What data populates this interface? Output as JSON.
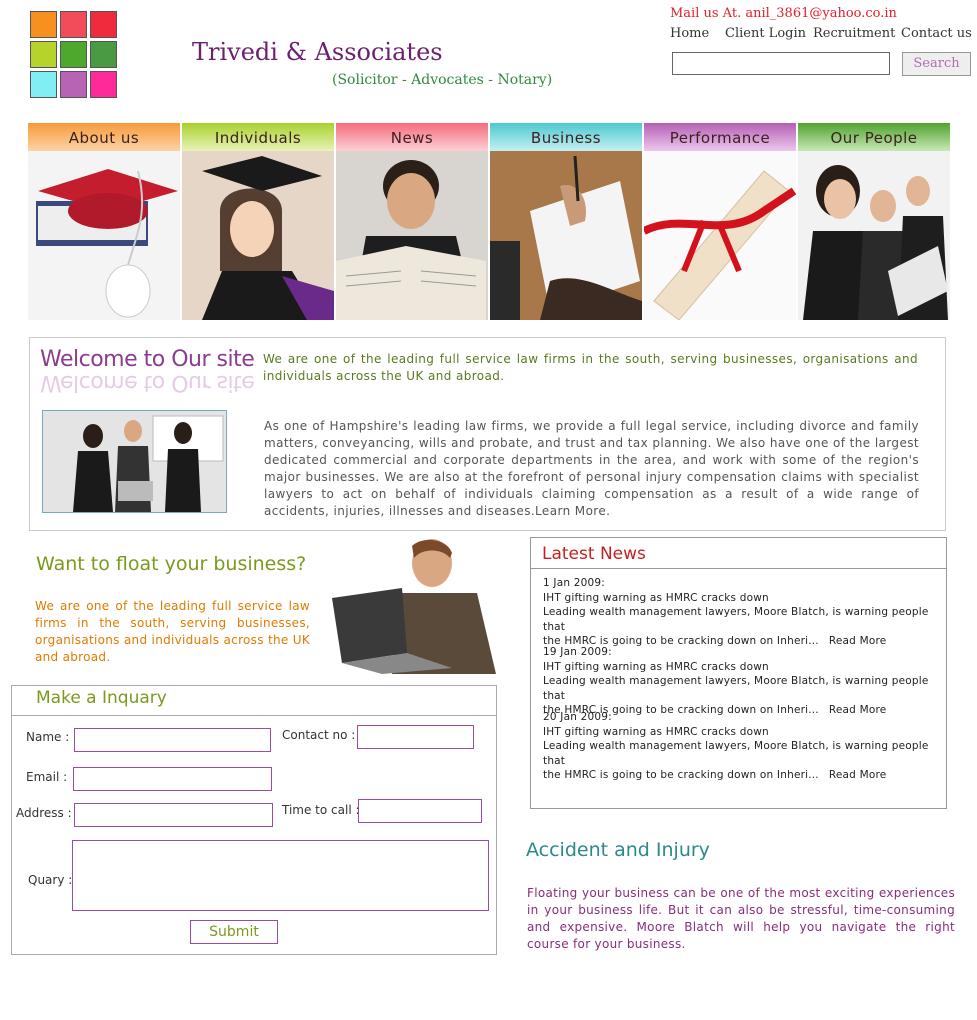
{
  "header": {
    "site_title": "Trivedi & Associates",
    "subtitle": "(Solicitor - Advocates - Notary)",
    "mail": "Mail us At. anil_3861@yahoo.co.in",
    "nav": [
      "Home",
      "Client Login",
      "Recruitment",
      "Contact us"
    ],
    "search_value": "",
    "search_button": "Search"
  },
  "logo_colors": [
    "#f7901e",
    "#f24b59",
    "#ef2b3d",
    "#b5d32a",
    "#4fa82e",
    "#4a9a44",
    "#80eef2",
    "#b864b4",
    "#ff2a9a"
  ],
  "categories": [
    {
      "label": "About us",
      "color_top": "#f79a3a",
      "color_bottom": "#fbd4a6"
    },
    {
      "label": "Individuals",
      "color_top": "#a9d12c",
      "color_bottom": "#e8f3b8"
    },
    {
      "label": "News",
      "color_top": "#f56b7d",
      "color_bottom": "#fcd0d6"
    },
    {
      "label": "Business",
      "color_top": "#4cc9cf",
      "color_bottom": "#c6eff1"
    },
    {
      "label": "Performance",
      "color_top": "#b45fb4",
      "color_bottom": "#ecc8ec"
    },
    {
      "label": "Our People",
      "color_top": "#4fa32e",
      "color_bottom": "#c9e8b8"
    }
  ],
  "welcome": {
    "title": "Welcome to Our site",
    "text1": "We are one of the leading full service law firms in the south, serving businesses, organisations and individuals across the UK and abroad.",
    "text2": "As one of Hampshire's leading law firms, we provide a full legal service, including divorce and family matters, conveyancing, wills and probate, and trust and tax planning. We also have one of the largest dedicated commercial and corporate departments in the area, and work with some of the region's major businesses. We are also at the forefront of personal injury compensation claims with specialist lawyers to act on behalf of individuals claiming compensation as a result of a wide range of accidents, injuries, illnesses and diseases.Learn More."
  },
  "float": {
    "title": "Want to float your business?",
    "text": "We are one of the leading full service law firms in the south, serving businesses, organisations and individuals across the UK and abroad."
  },
  "inquiry": {
    "title": "Make a Inquary",
    "name_label": "Name :",
    "contact_label": "Contact no :",
    "email_label": "Email :",
    "address_label": "Address :",
    "time_label": "Time to call :",
    "query_label": "Quary :",
    "submit": "Submit"
  },
  "news": {
    "title": "Latest News",
    "items": [
      {
        "date": "1 Jan 2009:",
        "headline": "IHT gifting warning as HMRC cracks down",
        "line1": "Leading wealth management lawyers, Moore Blatch, is warning people that",
        "line2": "the HMRC is going to be cracking down on Inheri...",
        "more": "Read More"
      },
      {
        "date": "19 Jan 2009:",
        "headline": "IHT gifting warning as HMRC cracks down",
        "line1": "Leading wealth management lawyers, Moore Blatch, is warning people that",
        "line2": "the HMRC is going to be cracking down on Inheri...",
        "more": "Read More"
      },
      {
        "date": "20 Jan 2009:",
        "headline": "IHT gifting warning as HMRC cracks down",
        "line1": "Leading wealth management lawyers, Moore Blatch, is warning people that",
        "line2": "the HMRC is going to be cracking down on Inheri...",
        "more": "Read More"
      }
    ]
  },
  "accident": {
    "title": "Accident and Injury",
    "text": "Floating your business can be one of the most exciting experiences in your business life. But it can also be stressful, time-consuming and expensive. Moore Blatch will help you navigate the right course for your business."
  }
}
